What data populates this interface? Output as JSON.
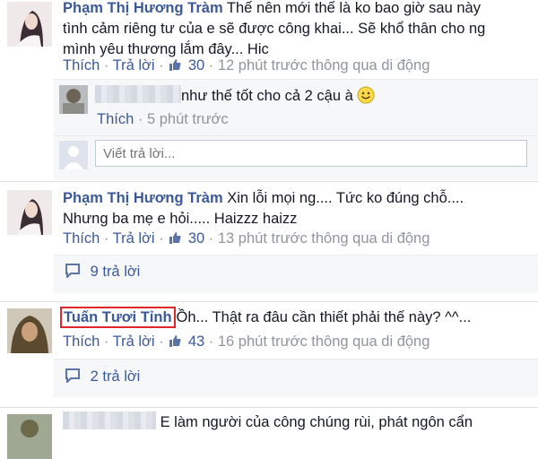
{
  "comments": [
    {
      "author": "Phạm Thị Hương Tràm",
      "text_line1": "Thế nên mới thế là ko bao giờ sau này",
      "text_line2": "tình cảm riêng tư của e sẽ được công khai... Sẽ khổ thân cho ng",
      "text_line3": "mình yêu thương lắm đây... Hic",
      "like_label": "Thích",
      "reply_label": "Trả lời",
      "like_count": "30",
      "time": "12 phút trước thông qua di động",
      "reply": {
        "text": "như thế tốt cho cả 2 cậu à",
        "like_label": "Thích",
        "time": "5 phút trước"
      },
      "reply_input_placeholder": "Viết trả lời..."
    },
    {
      "author": "Phạm Thị Hương Tràm",
      "text_line1": "Xin lỗi mọi ng.... Tức ko đúng chỗ....",
      "text_line2": "Nhưng ba mẹ e hỏi..... Haizzz haizz",
      "like_label": "Thích",
      "reply_label": "Trả lời",
      "like_count": "30",
      "time": "13 phút trước thông qua di động",
      "replies_count_label": "9 trả lời"
    },
    {
      "author": "Tuấn Tươi Tỉnh",
      "text_line1": "Ồh... Thật ra đâu cần thiết phải thế này? ^^...",
      "like_label": "Thích",
      "reply_label": "Trả lời",
      "like_count": "43",
      "time": "16 phút trước thông qua di động",
      "replies_count_label": "2 trả lời",
      "highlight_color": "#e0262a"
    },
    {
      "text_line1": "E làm người của công chúng rùi, phát ngôn cẩn"
    }
  ],
  "colors": {
    "link": "#3b5998",
    "meta": "#90949c",
    "highlight": "#e0262a"
  }
}
